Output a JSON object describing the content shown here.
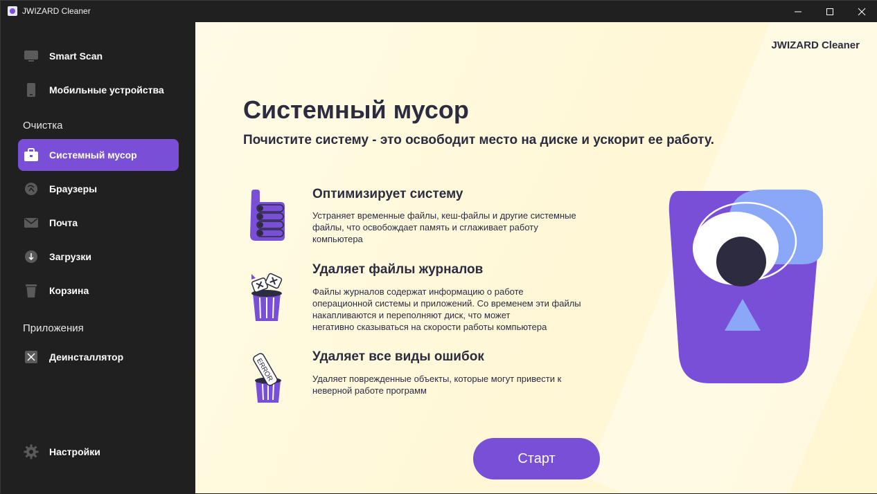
{
  "window": {
    "title": "JWIZARD Cleaner"
  },
  "sidebar": {
    "items_top": [
      {
        "label": "Smart Scan"
      },
      {
        "label": "Мобильные устройства"
      }
    ],
    "section_cleanup": "Очистка",
    "cleanup_items": [
      {
        "label": "Системный мусор"
      },
      {
        "label": "Браузеры"
      },
      {
        "label": "Почта"
      },
      {
        "label": "Загрузки"
      },
      {
        "label": "Корзина"
      }
    ],
    "section_apps": "Приложения",
    "apps_items": [
      {
        "label": "Деинсталлятор"
      }
    ],
    "settings": {
      "label": "Настройки"
    }
  },
  "main": {
    "brand": "JWIZARD Cleaner",
    "title": "Системный мусор",
    "subtitle": "Почистите систему - это освободит место на диске и ускорит ее работу.",
    "features": [
      {
        "title": "Оптимизирует систему",
        "desc_lines": [
          "Устраняет временные файлы, кеш-файлы и другие системные",
          "файлы, что освобождает память и сглаживает работу",
          "компьютера"
        ]
      },
      {
        "title": "Удаляет файлы журналов",
        "desc_lines": [
          "Файлы журналов содержат информацию о работе",
          "операционной системы и приложений. Со временем эти файлы",
          "накапливаются и переполняют диск, что может",
          "негативно сказываться на скорости работы компьютера"
        ]
      },
      {
        "title": "Удаляет все виды ошибок",
        "desc_lines": [
          "Удаляет поврежденные объекты, которые могут привести к",
          "неверной работе программ"
        ],
        "icon_text": "ERROR"
      }
    ],
    "start_button": "Старт"
  },
  "colors": {
    "accent": "#7a4fd8",
    "sidebar_bg": "#202020",
    "text_dark": "#2c2b40",
    "hero_light": "#8aa8f7"
  },
  "icons": [
    "app-icon",
    "monitor-icon",
    "phone-icon",
    "briefcase-icon",
    "browser-icon",
    "mail-icon",
    "download-icon",
    "trash-icon",
    "uninstall-icon",
    "gear-icon",
    "thumbs-up-icon",
    "trash-bin-icon",
    "error-bin-icon",
    "minimize-icon",
    "maximize-icon",
    "close-icon"
  ]
}
